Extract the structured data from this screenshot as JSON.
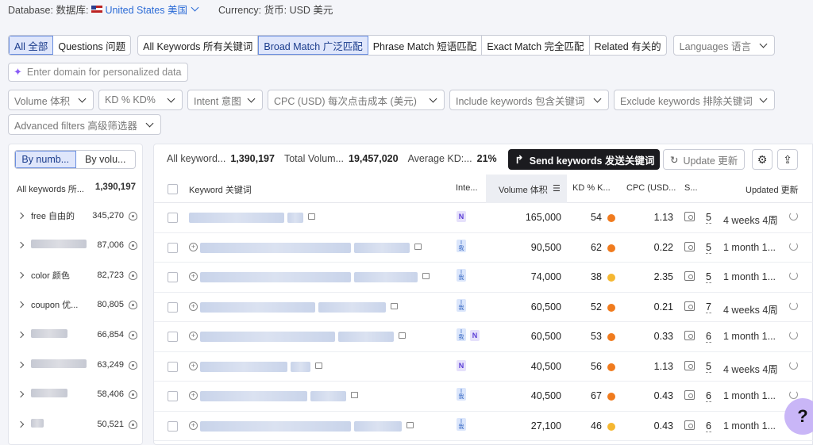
{
  "header": {
    "database_label": "Database: 数据库:",
    "country": "United States 美国",
    "currency_label": "Currency: 货币: USD 美元"
  },
  "scope_tabs": [
    {
      "label": "All 全部",
      "active": true
    },
    {
      "label": "Questions 问题",
      "active": false
    }
  ],
  "match_tabs": [
    {
      "label": "All Keywords 所有关键词",
      "active": false
    },
    {
      "label": "Broad Match 广泛匹配",
      "active": true
    },
    {
      "label": "Phrase Match 短语匹配",
      "active": false
    },
    {
      "label": "Exact Match 完全匹配",
      "active": false
    },
    {
      "label": "Related 有关的",
      "active": false
    }
  ],
  "languages_dd": "Languages 语言",
  "ai_input_placeholder": "Enter domain for personalized data",
  "filters": {
    "volume": "Volume 体积",
    "kd": "KD % KD%",
    "intent": "Intent 意图",
    "cpc": "CPC (USD) 每次点击成本 (美元)",
    "include": "Include keywords 包含关键词",
    "exclude": "Exclude keywords 排除关键词",
    "advanced": "Advanced filters 高级筛选器"
  },
  "left_panel": {
    "toggle": [
      "By numb...",
      "By volu..."
    ],
    "header_label": "All keywords 所...",
    "header_count": "1,390,197",
    "groups": [
      {
        "name": "free 自由的",
        "count": "345,270"
      },
      {
        "name": "",
        "count": "87,006"
      },
      {
        "name": "color 颜色",
        "count": "82,723"
      },
      {
        "name": "coupon 优...",
        "count": "80,805"
      },
      {
        "name": "",
        "count": "66,854"
      },
      {
        "name": "",
        "count": "63,249"
      },
      {
        "name": "",
        "count": "58,406"
      },
      {
        "name": "",
        "count": "50,521"
      }
    ]
  },
  "summary": {
    "all_keywords_label": "All keyword...",
    "all_keywords_value": "1,390,197",
    "total_volume_label": "Total Volum...",
    "total_volume_value": "19,457,020",
    "avg_kd_label": "Average KD:...",
    "avg_kd_value": "21%"
  },
  "buttons": {
    "send": "Send keywords 发送关键词",
    "update": "Update 更新"
  },
  "table": {
    "headers": {
      "keyword": "Keyword 关键词",
      "intent": "Inte...",
      "volume": "Volume 体积",
      "kd": "KD % K...",
      "cpc": "CPC (USD...",
      "serp": "S...",
      "updated": "Updated 更新"
    },
    "rows": [
      {
        "intent": "N",
        "volume": "165,000",
        "kd": "54",
        "kd_color": "#f07b1e",
        "cpc": "1.13",
        "serp": "5",
        "updated": "4 weeks 4周"
      },
      {
        "intent": "I",
        "volume": "90,500",
        "kd": "62",
        "kd_color": "#f07b1e",
        "cpc": "0.22",
        "serp": "5",
        "updated": "1 month 1..."
      },
      {
        "intent": "I",
        "volume": "74,000",
        "kd": "38",
        "kd_color": "#f5b731",
        "cpc": "2.35",
        "serp": "5",
        "updated": "1 month 1..."
      },
      {
        "intent": "I",
        "volume": "60,500",
        "kd": "52",
        "kd_color": "#f07b1e",
        "cpc": "0.21",
        "serp": "7",
        "updated": "4 weeks 4周"
      },
      {
        "intent": "IN",
        "volume": "60,500",
        "kd": "53",
        "kd_color": "#f07b1e",
        "cpc": "0.33",
        "serp": "6",
        "updated": "1 month 1..."
      },
      {
        "intent": "N",
        "volume": "40,500",
        "kd": "56",
        "kd_color": "#f07b1e",
        "cpc": "1.13",
        "serp": "5",
        "updated": "4 weeks 4周"
      },
      {
        "intent": "I",
        "volume": "40,500",
        "kd": "67",
        "kd_color": "#f07b1e",
        "cpc": "0.43",
        "serp": "6",
        "updated": "1 month 1..."
      },
      {
        "intent": "I",
        "volume": "27,100",
        "kd": "46",
        "kd_color": "#f5b731",
        "cpc": "0.43",
        "serp": "6",
        "updated": "1 month 1..."
      }
    ],
    "intent_I_sub": "我"
  },
  "help_label": "?"
}
